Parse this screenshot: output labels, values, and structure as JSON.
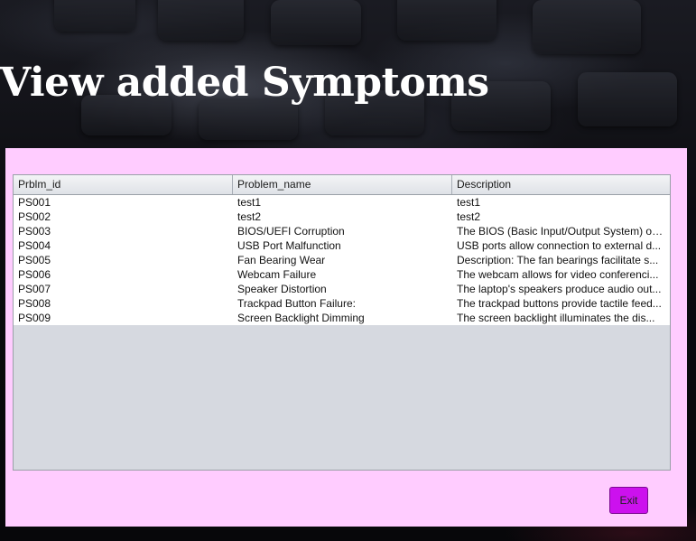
{
  "page": {
    "title": "View added Symptoms"
  },
  "table": {
    "columns": [
      "Prblm_id",
      "Problem_name",
      "Description"
    ],
    "rows": [
      [
        "PS001",
        "test1",
        "test1"
      ],
      [
        "PS002",
        "test2",
        "test2"
      ],
      [
        "PS003",
        "BIOS/UEFI Corruption",
        "The BIOS (Basic Input/Output System) or ..."
      ],
      [
        "PS004",
        "USB Port Malfunction",
        "USB ports allow connection to external d..."
      ],
      [
        "PS005",
        "Fan Bearing Wear",
        "Description: The fan bearings facilitate s..."
      ],
      [
        "PS006",
        "Webcam Failure",
        "The webcam allows for video conferenci..."
      ],
      [
        "PS007",
        "Speaker Distortion",
        "The laptop's speakers produce audio out..."
      ],
      [
        "PS008",
        "Trackpad Button Failure:",
        "The trackpad buttons provide tactile feed..."
      ],
      [
        "PS009",
        "Screen Backlight Dimming",
        "The screen backlight illuminates the dis..."
      ]
    ]
  },
  "actions": {
    "exit_label": "Exit"
  },
  "colors": {
    "panel": "#ffccff",
    "exit_button": "#cc11ee",
    "title_text": "#ffffff"
  }
}
